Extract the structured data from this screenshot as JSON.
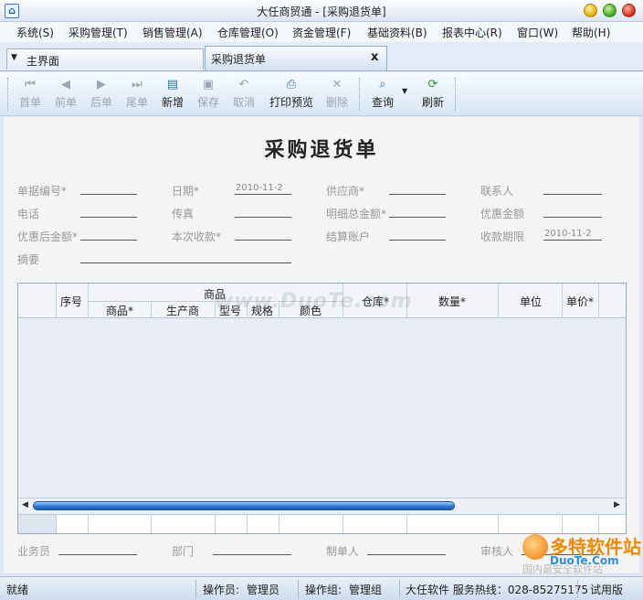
{
  "window": {
    "title": "大任商贸通 - [采购退货单]",
    "app_icon": "home-icon"
  },
  "menu": [
    "系统(S)",
    "采购管理(T)",
    "销售管理(A)",
    "仓库管理(O)",
    "资金管理(F)",
    "基础资料(B)",
    "报表中心(R)",
    "窗口(W)",
    "帮助(H)"
  ],
  "tabs": {
    "main": "主界面",
    "active": "采购退货单",
    "close": "x"
  },
  "toolbar": {
    "first": "首单",
    "prev": "前单",
    "next": "后单",
    "last": "尾单",
    "add": "新增",
    "save": "保存",
    "cancel": "取消",
    "print": "打印预览",
    "delete": "删除",
    "query": "查询",
    "refresh": "刷新"
  },
  "form": {
    "title": "采购退货单",
    "labels": {
      "doc_no": "单据编号*",
      "date": "日期*",
      "supplier": "供应商*",
      "contact": "联系人",
      "phone": "电话",
      "fax": "传真",
      "detail_total": "明细总金额*",
      "discount": "优惠金额",
      "after_discount": "优惠后金额*",
      "received": "本次收款*",
      "account": "结算账户",
      "due_date": "收款期限",
      "memo": "摘要"
    },
    "values": {
      "date": "2010-11-2",
      "due_date": "2010-11-2"
    }
  },
  "grid": {
    "group_header": "商品",
    "columns": {
      "seq": "序号",
      "product": "商品*",
      "maker": "生产商",
      "model": "型号",
      "spec": "规格",
      "color": "颜色",
      "warehouse": "仓库*",
      "qty": "数量*",
      "unit": "单位",
      "price": "单价*"
    },
    "rows": [],
    "watermark": "www.DuoTe.com"
  },
  "footer_form": {
    "salesman": "业务员",
    "dept": "部门",
    "maker": "制单人",
    "auditor": "审核人"
  },
  "status": {
    "ready": "就绪",
    "operator_label": "操作员:",
    "operator": "管理员",
    "group_label": "操作组:",
    "group": "管理组",
    "hotline": "大任软件 服务热线：028-85275175",
    "edition": "试用版"
  },
  "logo": {
    "main": "多特软件站",
    "sub": "DuoTe.Com",
    "tag": "国内最安全软件站"
  }
}
